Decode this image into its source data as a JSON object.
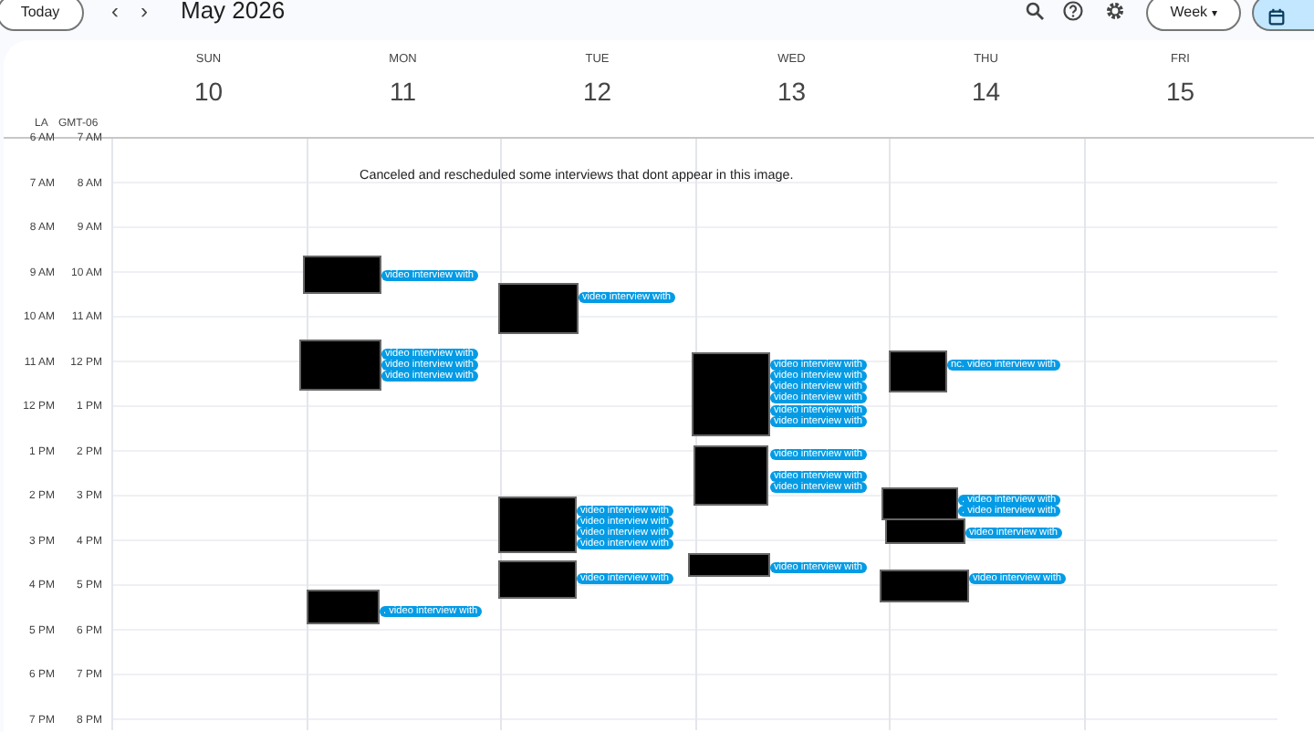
{
  "toolbar": {
    "today_button": "Today",
    "prev": "‹",
    "next": "›",
    "title": "May 2026",
    "view_button": "Week",
    "view_caret": "▾"
  },
  "timezones": [
    "LA",
    "GMT-06"
  ],
  "days": [
    {
      "weekday": "SUN",
      "date": "10"
    },
    {
      "weekday": "MON",
      "date": "11",
      "events": [
        {
          "label": "video interview with"
        },
        {
          "label": "video interview with"
        },
        {
          "label": "video interview with"
        },
        {
          "label": "video interview with"
        },
        {
          "label": ". video interview with"
        }
      ]
    },
    {
      "weekday": "TUE",
      "date": "12",
      "events": [
        {
          "label": "video interview with"
        },
        {
          "label": "video interview with"
        },
        {
          "label": "video interview with"
        },
        {
          "label": "video interview with"
        },
        {
          "label": "video interview with"
        },
        {
          "label": "video interview with"
        }
      ]
    },
    {
      "weekday": "WED",
      "date": "13",
      "events": [
        {
          "label": "video interview with"
        },
        {
          "label": "video interview with"
        },
        {
          "label": "video interview with"
        },
        {
          "label": "video interview with"
        },
        {
          "label": "video interview with"
        },
        {
          "label": "video interview with"
        },
        {
          "label": "video interview with"
        },
        {
          "label": "video interview with"
        },
        {
          "label": "video interview with"
        },
        {
          "label": "video interview with"
        }
      ]
    },
    {
      "weekday": "THU",
      "date": "14",
      "events": [
        {
          "label": "nc. video interview with"
        },
        {
          "label": ". video interview with"
        },
        {
          "label": ". video interview with"
        },
        {
          "label": "video interview with"
        },
        {
          "label": "video interview with"
        }
      ]
    },
    {
      "weekday": "FRI",
      "date": "15"
    }
  ],
  "hours_la": [
    "6 AM",
    "7 AM",
    "8 AM",
    "9 AM",
    "10 AM",
    "11 AM",
    "12 PM",
    "1 PM",
    "2 PM",
    "3 PM",
    "4 PM",
    "5 PM",
    "6 PM",
    "7 PM"
  ],
  "hours_gmt": [
    "7 AM",
    "8 AM",
    "9 AM",
    "10 AM",
    "11 AM",
    "12 PM",
    "1 PM",
    "2 PM",
    "3 PM",
    "4 PM",
    "5 PM",
    "6 PM",
    "7 PM",
    "8 PM"
  ],
  "note": "Canceled and rescheduled some interviews that dont appear in this image."
}
